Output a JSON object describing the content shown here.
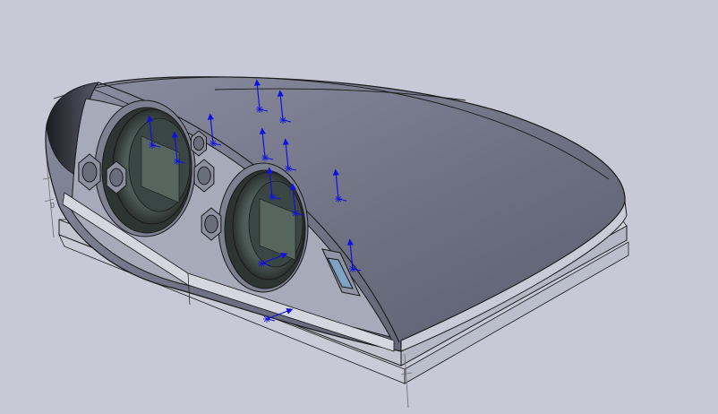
{
  "viewport": {
    "background": "#c7cad6",
    "model_color": "#6e7283",
    "edge_color": "#1a1a1a",
    "glass_color": "#4a5a55",
    "triad_color": "#1010e0"
  },
  "model": {
    "parts": [
      "shell",
      "base-plate",
      "front-panel",
      "lens-left",
      "lens-right",
      "nut",
      "sensor-window"
    ],
    "dimension_note": "0"
  },
  "triads": {
    "count": 15,
    "icon": "coordinate-triad-icon"
  }
}
